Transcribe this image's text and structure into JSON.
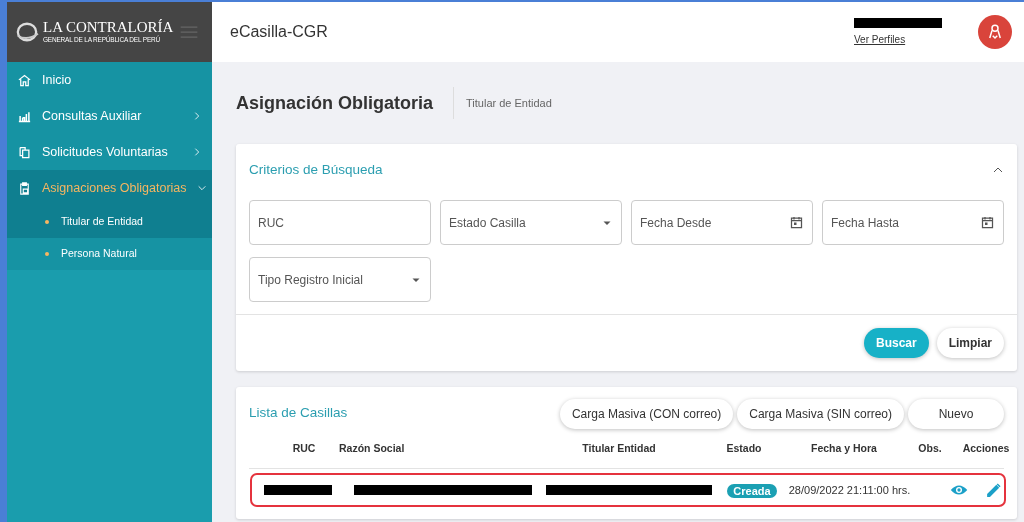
{
  "brand": {
    "title": "LA CONTRALORÍA",
    "subtitle": "GENERAL DE LA REPÚBLICA DEL PERÚ"
  },
  "sidebar": {
    "items": [
      {
        "kind": "link",
        "label": "Inicio",
        "selected": false
      },
      {
        "kind": "group",
        "label": "Consultas Auxiliar",
        "selected": false,
        "expanded": false
      },
      {
        "kind": "group",
        "label": "Solicitudes Voluntarias",
        "selected": false,
        "expanded": false
      },
      {
        "kind": "group",
        "label": "Asignaciones Obligatorias",
        "selected": true,
        "expanded": true,
        "children": [
          {
            "label": "Titular de Entidad",
            "selected": true
          },
          {
            "label": "Persona Natural",
            "selected": false
          }
        ]
      }
    ]
  },
  "header": {
    "app_name": "eCasilla-CGR",
    "user": {
      "name_redacted": true,
      "link": "Ver Perfiles"
    }
  },
  "page": {
    "title": "Asignación Obligatoria",
    "breadcrumb": "Titular de Entidad"
  },
  "search_card": {
    "title": "Criterios de Búsqueda",
    "expanded": true,
    "fields": [
      {
        "kind": "text",
        "placeholder": "RUC"
      },
      {
        "kind": "select",
        "placeholder": "Estado Casilla"
      },
      {
        "kind": "date",
        "placeholder": "Fecha Desde"
      },
      {
        "kind": "date",
        "placeholder": "Fecha Hasta"
      },
      {
        "kind": "select",
        "placeholder": "Tipo Registro Inicial"
      }
    ],
    "buttons": [
      {
        "label": "Buscar",
        "kind": "primary"
      },
      {
        "label": "Limpiar",
        "kind": "secondary"
      }
    ]
  },
  "list_card": {
    "title": "Lista de Casillas",
    "buttons": [
      "Carga Masiva (CON correo)",
      "Carga Masiva (SIN correo)",
      "Nuevo"
    ],
    "table": {
      "columns": [
        "RUC",
        "Razón Social",
        "Titular Entidad",
        "Estado",
        "Fecha y Hora",
        "Obs.",
        "Acciones"
      ],
      "rows": [
        {
          "highlighted": true,
          "ruc": {
            "kind": "redacted"
          },
          "razon_social": {
            "kind": "redacted"
          },
          "titular": {
            "kind": "redacted"
          },
          "estado": "Creada",
          "fecha": "28/09/2022 21:11:00 hrs."
        }
      ]
    }
  }
}
